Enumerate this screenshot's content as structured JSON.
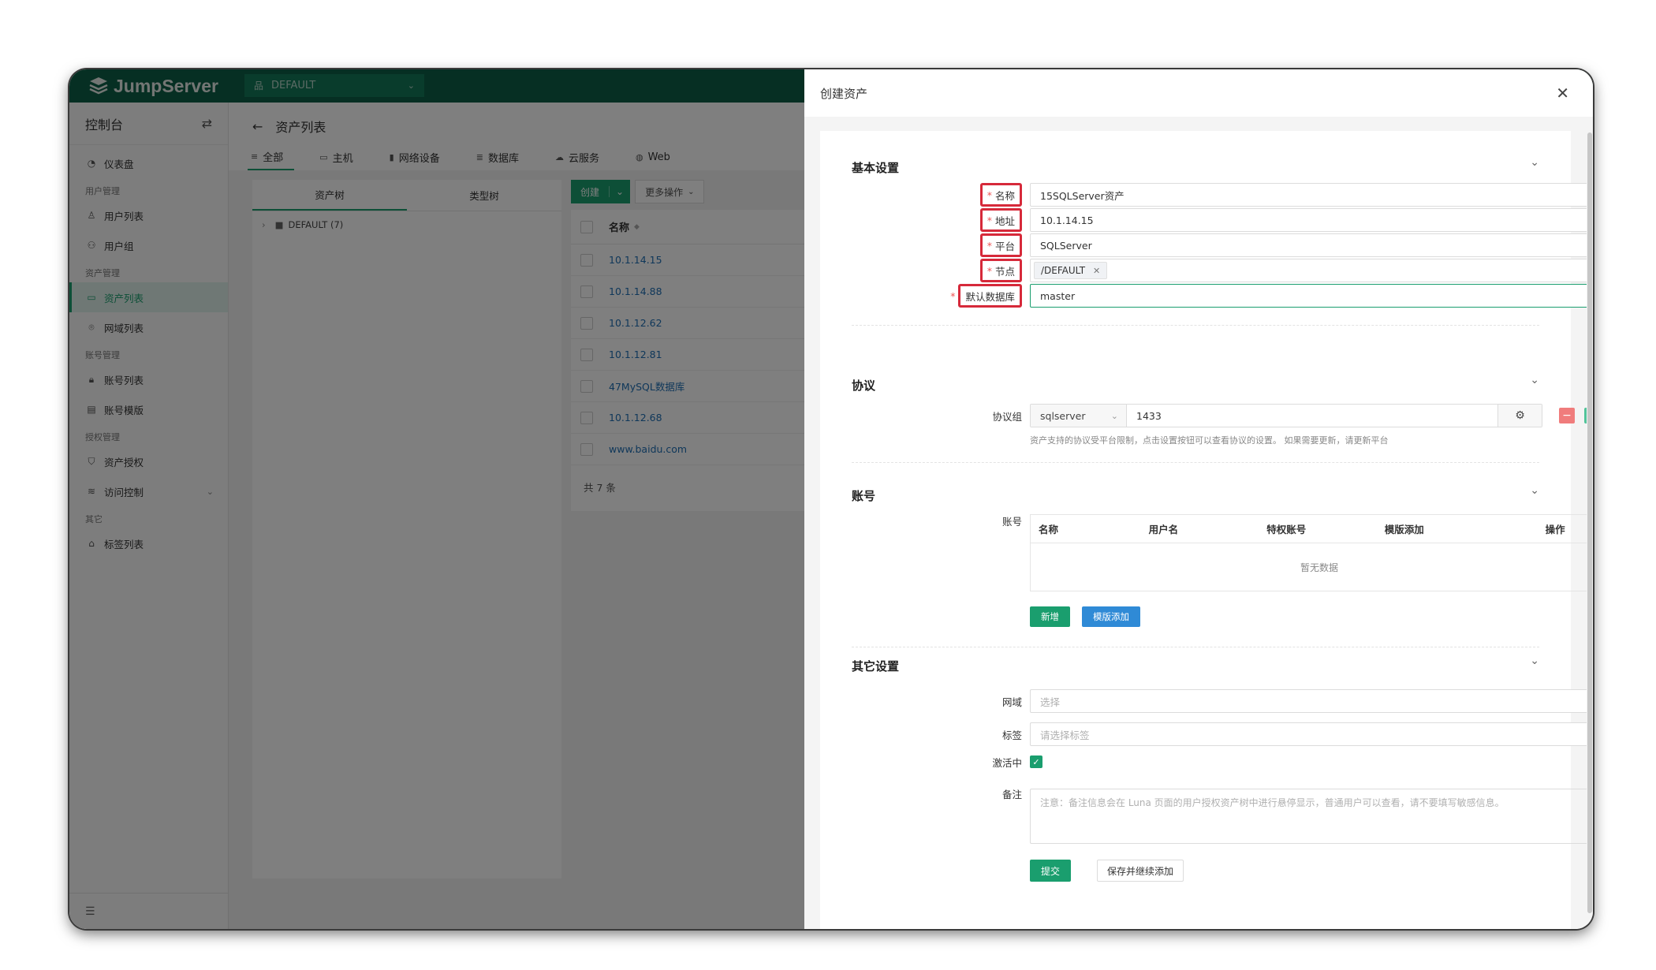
{
  "app": {
    "logo_text": "JumpServer",
    "org": "DEFAULT"
  },
  "sidebar": {
    "header": "控制台",
    "items": [
      {
        "type": "item",
        "label": "仪表盘",
        "icon": "dashboard-icon"
      },
      {
        "type": "group",
        "label": "用户管理"
      },
      {
        "type": "item",
        "label": "用户列表",
        "icon": "user-icon"
      },
      {
        "type": "item",
        "label": "用户组",
        "icon": "users-icon"
      },
      {
        "type": "group",
        "label": "资产管理"
      },
      {
        "type": "item",
        "label": "资产列表",
        "icon": "asset-icon",
        "active": true
      },
      {
        "type": "item",
        "label": "网域列表",
        "icon": "location-icon"
      },
      {
        "type": "group",
        "label": "账号管理"
      },
      {
        "type": "item",
        "label": "账号列表",
        "icon": "lock-icon"
      },
      {
        "type": "item",
        "label": "账号模版",
        "icon": "template-icon"
      },
      {
        "type": "group",
        "label": "授权管理"
      },
      {
        "type": "item",
        "label": "资产授权",
        "icon": "shield-icon"
      },
      {
        "type": "item",
        "label": "访问控制",
        "icon": "filter-icon",
        "expandable": true
      },
      {
        "type": "group",
        "label": "其它"
      },
      {
        "type": "item",
        "label": "标签列表",
        "icon": "tag-icon"
      }
    ]
  },
  "main": {
    "title": "资产列表",
    "tabs": [
      {
        "label": "全部",
        "icon": "list-icon",
        "active": true
      },
      {
        "label": "主机",
        "icon": "host-icon"
      },
      {
        "label": "网络设备",
        "icon": "network-icon"
      },
      {
        "label": "数据库",
        "icon": "database-icon"
      },
      {
        "label": "云服务",
        "icon": "cloud-icon"
      },
      {
        "label": "Web",
        "icon": "globe-icon"
      }
    ],
    "tree_tabs": [
      "资产树",
      "类型树"
    ],
    "tree_node": "DEFAULT (7)",
    "toolbar": {
      "create": "创建",
      "more": "更多操作"
    },
    "table": {
      "column": "名称",
      "rows": [
        "10.1.14.15",
        "10.1.14.88",
        "10.1.12.62",
        "10.1.12.81",
        "47MySQL数据库",
        "10.1.12.68",
        "www.baidu.com"
      ],
      "total": "共 7 条"
    }
  },
  "drawer": {
    "title": "创建资产",
    "basic": {
      "title": "基本设置",
      "name_label": "名称",
      "name_value": "15SQLServer资产",
      "address_label": "地址",
      "address_value": "10.1.14.15",
      "platform_label": "平台",
      "platform_value": "SQLServer",
      "node_label": "节点",
      "node_tag": "/DEFAULT",
      "db_label": "默认数据库",
      "db_value": "master"
    },
    "protocol": {
      "title": "协议",
      "label": "协议组",
      "name": "sqlserver",
      "port": "1433",
      "hint": "资产支持的协议受平台限制，点击设置按钮可以查看协议的设置。 如果需要更新，请更新平台"
    },
    "account": {
      "title": "账号",
      "label": "账号",
      "columns": [
        "名称",
        "用户名",
        "特权账号",
        "模版添加",
        "操作"
      ],
      "empty": "暂无数据",
      "add_btn": "新增",
      "template_btn": "模版添加"
    },
    "other": {
      "title": "其它设置",
      "domain_label": "网域",
      "domain_placeholder": "选择",
      "labels_label": "标签",
      "labels_placeholder": "请选择标签",
      "active_label": "激活中",
      "comment_label": "备注",
      "comment_placeholder": "注意：备注信息会在 Luna 页面的用户授权资产树中进行悬停显示，普通用户可以查看，请不要填写敏感信息。"
    },
    "submit": "提交",
    "save_continue": "保存并继续添加"
  },
  "colors": {
    "brand": "#1a9e6e",
    "topbar": "#0c5f46",
    "link": "#1f6fb4",
    "required_highlight": "#d6293a",
    "minus_btn": "#f07c7c",
    "plus_btn": "#52c49a",
    "template_btn": "#2f8ad6"
  }
}
